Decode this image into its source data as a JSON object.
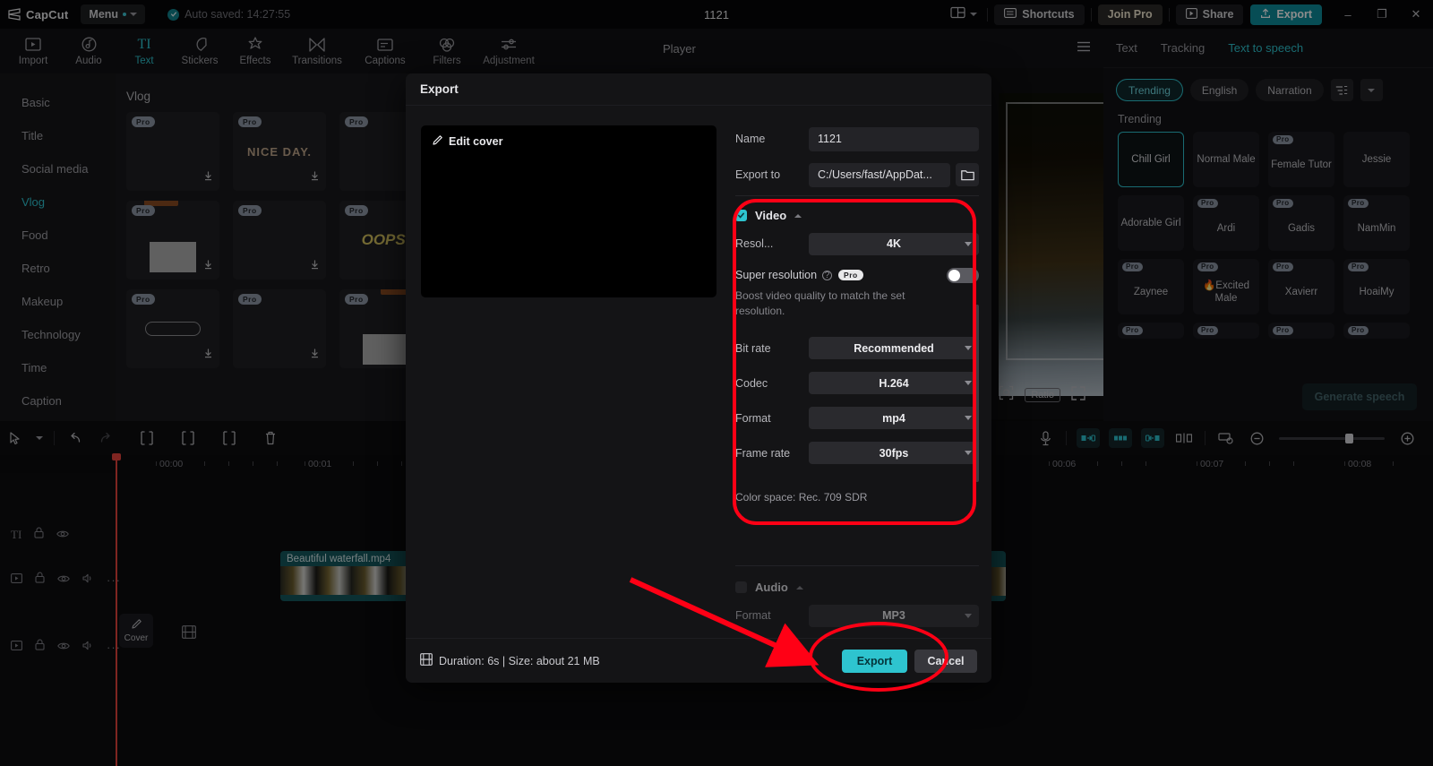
{
  "titlebar": {
    "app_name": "CapCut",
    "menu_label": "Menu",
    "autosave": "Auto saved: 14:27:55",
    "project_title": "1121",
    "shortcuts": "Shortcuts",
    "join_pro": "Join Pro",
    "share": "Share",
    "export": "Export",
    "minimize": "–",
    "maximize": "❐",
    "close": "✕",
    "accent_teal": "#2ec4cf",
    "export_btn_bg": "#0e8d9c"
  },
  "topnav": [
    {
      "label": "Import",
      "icon": "import-icon",
      "active": false
    },
    {
      "label": "Audio",
      "icon": "audio-icon",
      "active": false
    },
    {
      "label": "Text",
      "icon": "text-icon",
      "active": true
    },
    {
      "label": "Stickers",
      "icon": "stickers-icon",
      "active": false
    },
    {
      "label": "Effects",
      "icon": "effects-icon",
      "active": false
    },
    {
      "label": "Transitions",
      "icon": "transitions-icon",
      "active": false
    },
    {
      "label": "Captions",
      "icon": "captions-icon",
      "active": false
    },
    {
      "label": "Filters",
      "icon": "filters-icon",
      "active": false
    },
    {
      "label": "Adjustment",
      "icon": "adjustment-icon",
      "active": false
    }
  ],
  "categories": [
    {
      "label": "Basic",
      "active": false
    },
    {
      "label": "Title",
      "active": false
    },
    {
      "label": "Social media",
      "active": false
    },
    {
      "label": "Vlog",
      "active": true
    },
    {
      "label": "Food",
      "active": false
    },
    {
      "label": "Retro",
      "active": false
    },
    {
      "label": "Makeup",
      "active": false
    },
    {
      "label": "Technology",
      "active": false
    },
    {
      "label": "Time",
      "active": false
    },
    {
      "label": "Caption",
      "active": false
    }
  ],
  "templates": {
    "heading": "Vlog",
    "pro_badge": "Pro",
    "cards": [
      {
        "badge": "Pro",
        "art": "",
        "hot": false
      },
      {
        "badge": "Pro",
        "art": "NICE DAY.",
        "hot": false
      },
      {
        "badge": "Pro",
        "art": "",
        "hot": false
      },
      {
        "badge": "Pro",
        "art": "",
        "hot": true
      },
      {
        "badge": "Pro",
        "art": "",
        "hot": false
      },
      {
        "badge": "Pro",
        "art": "OOPS!",
        "hot": false
      },
      {
        "badge": "Pro",
        "art": "",
        "hot": false
      },
      {
        "badge": "Pro",
        "art": "",
        "hot": false
      },
      {
        "badge": "Pro",
        "art": "",
        "hot": true
      }
    ]
  },
  "player": {
    "title": "Player",
    "ratio_label": "Ratio"
  },
  "right_panel": {
    "tabs": [
      {
        "label": "Text",
        "active": false
      },
      {
        "label": "Tracking",
        "active": false
      },
      {
        "label": "Text to speech",
        "active": true
      }
    ],
    "filters": [
      {
        "label": "Trending",
        "active": true
      },
      {
        "label": "English",
        "active": false
      },
      {
        "label": "Narration",
        "active": false
      }
    ],
    "section_title": "Trending",
    "pro_badge": "Pro",
    "voices": [
      {
        "name": "Chill Girl",
        "pro": false,
        "active": true
      },
      {
        "name": "Normal Male",
        "pro": false,
        "active": false
      },
      {
        "name": "Female Tutor",
        "pro": true,
        "active": false
      },
      {
        "name": "Jessie",
        "pro": false,
        "active": false
      },
      {
        "name": "Adorable Girl",
        "pro": false,
        "active": false
      },
      {
        "name": "Ardi",
        "pro": true,
        "active": false
      },
      {
        "name": "Gadis",
        "pro": true,
        "active": false
      },
      {
        "name": "NamMin",
        "pro": true,
        "active": false
      },
      {
        "name": "Zaynee",
        "pro": true,
        "active": false
      },
      {
        "name": "🔥Excited Male",
        "pro": true,
        "active": false
      },
      {
        "name": "Xavierr",
        "pro": true,
        "active": false
      },
      {
        "name": "HoaiMy",
        "pro": true,
        "active": false
      }
    ],
    "generate_speech": "Generate speech"
  },
  "timeline": {
    "ruler_marks": [
      "00:00",
      "00:01",
      "00:06",
      "00:07",
      "00:08"
    ],
    "clip_label": "Beautiful waterfall.mp4",
    "cover_label": "Cover"
  },
  "export_dialog": {
    "title": "Export",
    "edit_cover": "Edit cover",
    "name_label": "Name",
    "name_value": "1121",
    "export_to_label": "Export to",
    "export_to_value": "C:/Users/fast/AppDat...",
    "video": {
      "section_label": "Video",
      "checked": true,
      "resolution_label": "Resol...",
      "resolution_value": "4K",
      "super_resolution_label": "Super resolution",
      "super_resolution_pro": "Pro",
      "super_resolution_on": false,
      "super_resolution_hint": "Boost video quality to match the set resolution.",
      "bitrate_label": "Bit rate",
      "bitrate_value": "Recommended",
      "codec_label": "Codec",
      "codec_value": "H.264",
      "format_label": "Format",
      "format_value": "mp4",
      "framerate_label": "Frame rate",
      "framerate_value": "30fps",
      "color_space": "Color space: Rec. 709 SDR"
    },
    "audio": {
      "section_label": "Audio",
      "checked": false,
      "format_label": "Format",
      "format_value": "MP3"
    },
    "footer": {
      "duration": "Duration: 6s | Size: about 21 MB",
      "export_button": "Export",
      "cancel_button": "Cancel"
    }
  },
  "annotations": {
    "highlight_color": "#ff0015",
    "shapes": [
      "video-settings-rectangle",
      "export-button-oval",
      "pointer-arrow"
    ]
  }
}
